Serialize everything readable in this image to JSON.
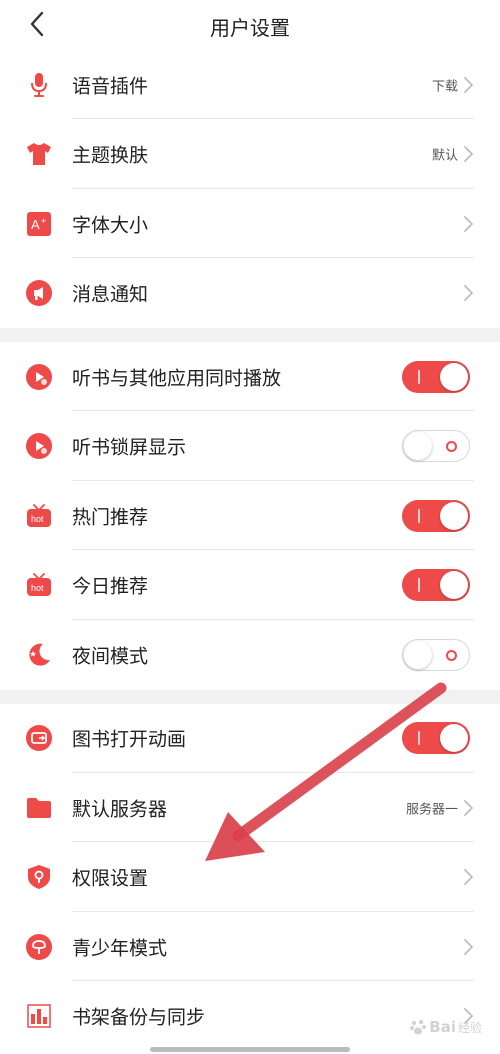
{
  "header": {
    "title": "用户设置"
  },
  "colors": {
    "accent": "#ee4a4a",
    "separator": "#f1f1f1",
    "divider": "#e8e8e8"
  },
  "section1": [
    {
      "id": "voice-plugin",
      "icon": "microphone-icon",
      "label": "语音插件",
      "value": "下载"
    },
    {
      "id": "theme",
      "icon": "shirt-icon",
      "label": "主题换肤",
      "value": "默认"
    },
    {
      "id": "font-size",
      "icon": "font-size-icon",
      "label": "字体大小",
      "value": ""
    },
    {
      "id": "notifications",
      "icon": "megaphone-icon",
      "label": "消息通知",
      "value": ""
    }
  ],
  "section2": [
    {
      "id": "background-play",
      "icon": "play-icon",
      "label": "听书与其他应用同时播放",
      "on": true
    },
    {
      "id": "lockscreen",
      "icon": "play-icon",
      "label": "听书锁屏显示",
      "on": false
    },
    {
      "id": "hot-recommend",
      "icon": "hot-tv-icon",
      "label": "热门推荐",
      "on": true
    },
    {
      "id": "today-recommend",
      "icon": "hot-tv-icon",
      "label": "今日推荐",
      "on": true
    },
    {
      "id": "night-mode",
      "icon": "moon-icon",
      "label": "夜间模式",
      "on": false
    }
  ],
  "section3": [
    {
      "id": "book-animation",
      "icon": "book-animation-icon",
      "label": "图书打开动画",
      "type": "toggle",
      "on": true
    },
    {
      "id": "default-server",
      "icon": "folder-icon",
      "label": "默认服务器",
      "type": "link",
      "value": "服务器一"
    },
    {
      "id": "permissions",
      "icon": "shield-icon",
      "label": "权限设置",
      "type": "link",
      "value": ""
    },
    {
      "id": "youth-mode",
      "icon": "sprout-icon",
      "label": "青少年模式",
      "type": "link",
      "value": ""
    },
    {
      "id": "bookshelf-sync",
      "icon": "chart-icon",
      "label": "书架备份与同步",
      "type": "link",
      "value": ""
    }
  ],
  "watermark": {
    "text": "Bai",
    "sub": "经验"
  }
}
